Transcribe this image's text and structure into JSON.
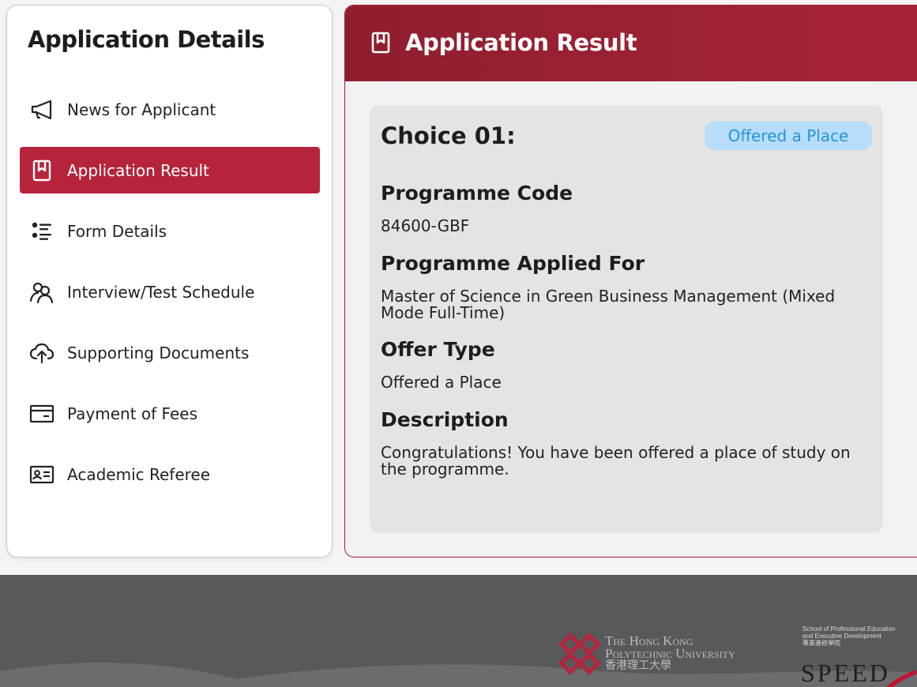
{
  "sidebar": {
    "title": "Application Details",
    "items": [
      {
        "label": "News for Applicant",
        "icon": "megaphone-icon"
      },
      {
        "label": "Application Result",
        "icon": "bookmark-icon",
        "active": true
      },
      {
        "label": "Form Details",
        "icon": "list-icon"
      },
      {
        "label": "Interview/Test Schedule",
        "icon": "users-icon"
      },
      {
        "label": "Supporting Documents",
        "icon": "cloud-upload-icon"
      },
      {
        "label": "Payment of Fees",
        "icon": "credit-card-icon"
      },
      {
        "label": "Academic Referee",
        "icon": "id-card-icon"
      }
    ]
  },
  "main": {
    "title": "Application Result",
    "icon": "bookmark-icon",
    "card": {
      "choice_title": "Choice 01:",
      "status_badge": "Offered a Place",
      "fields": [
        {
          "label": "Programme Code",
          "value": "84600-GBF"
        },
        {
          "label": "Programme Applied For",
          "value": "Master of Science in Green Business Management (Mixed Mode Full-Time)"
        },
        {
          "label": "Offer Type",
          "value": "Offered a Place"
        },
        {
          "label": "Description",
          "value": "Congratulations! You have been offered a place of study on the programme."
        }
      ]
    }
  },
  "footer": {
    "polyu_line1": "The Hong Kong",
    "polyu_line2": "Polytechnic University",
    "polyu_cn": "香港理工大學",
    "speed_small_1": "School of Professional Education",
    "speed_small_2": "and Executive Development",
    "speed_small_3": "專業進修學院",
    "speed_big": "SPEED"
  },
  "colors": {
    "accent": "#b5243b",
    "header_dark": "#8f1e2e",
    "badge_bg": "#b7ddfa",
    "badge_text": "#2693dd",
    "footer_bg": "#58595b"
  }
}
